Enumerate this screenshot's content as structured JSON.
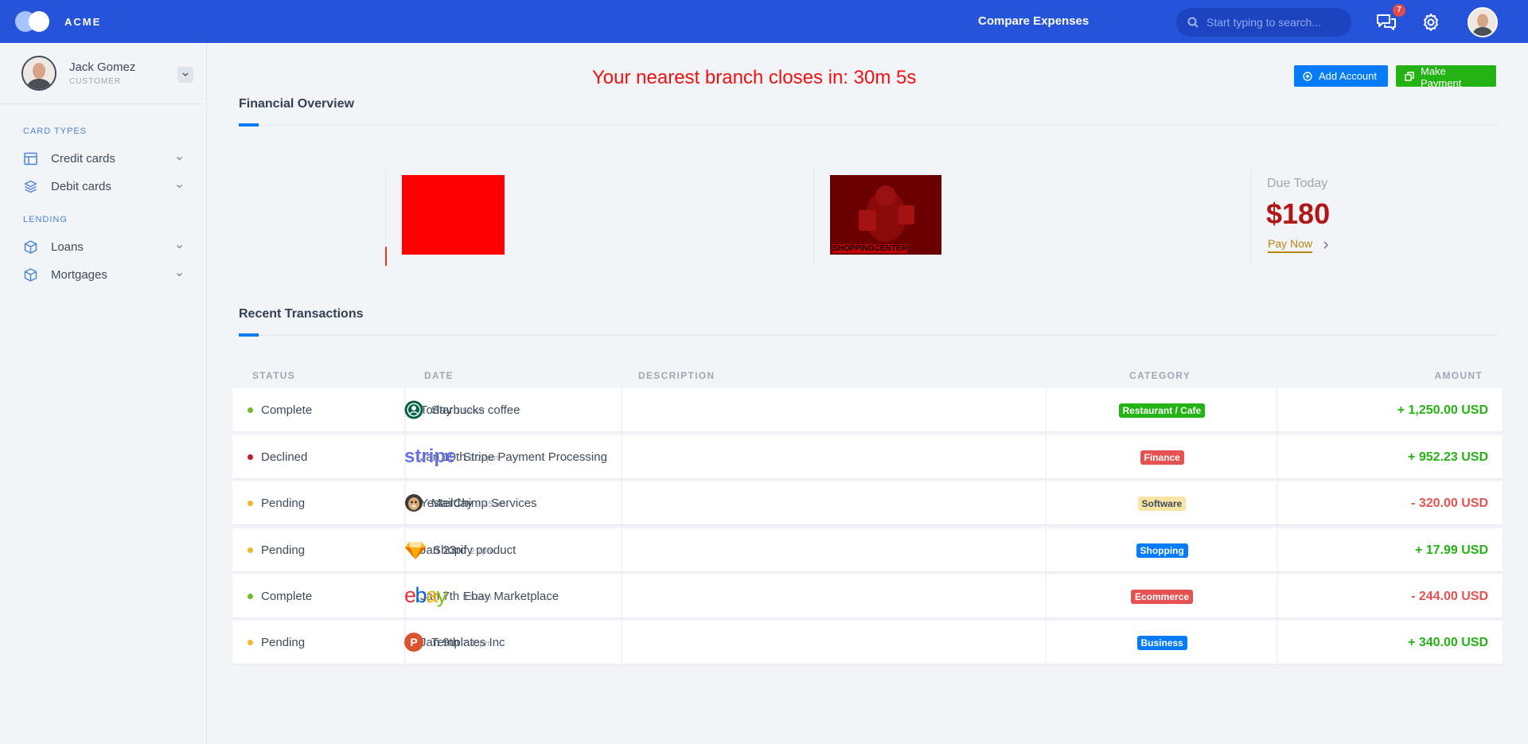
{
  "topbar": {
    "brand": "ACME",
    "compare_link": "Compare Expenses",
    "search_placeholder": "Start typing to search...",
    "messages_count": "7"
  },
  "sidebar": {
    "user_name": "Jack Gomez",
    "user_role": "CUSTOMER",
    "sections": [
      {
        "label": "CARD TYPES",
        "items": [
          {
            "label": "Credit cards",
            "icon": "layout-icon"
          },
          {
            "label": "Debit cards",
            "icon": "layers-icon"
          }
        ]
      },
      {
        "label": "LENDING",
        "items": [
          {
            "label": "Loans",
            "icon": "box-icon"
          },
          {
            "label": "Mortgages",
            "icon": "box-icon"
          }
        ]
      }
    ]
  },
  "main": {
    "countdown": "Your nearest branch closes in: 30m 5s",
    "add_account_label": "Add Account",
    "make_payment_label": "Make Payment",
    "financial_overview_title": "Financial Overview",
    "promo_text": "SHOPPINGCENTER",
    "due_label": "Due Today",
    "due_amount": "$180",
    "pay_now_label": "Pay Now",
    "recent_transactions_title": "Recent Transactions"
  },
  "table": {
    "headers": {
      "status": "STATUS",
      "date": "DATE",
      "description": "DESCRIPTION",
      "category": "CATEGORY",
      "amount": "AMOUNT"
    },
    "rows": [
      {
        "status": "Complete",
        "status_color": "#6fbf2a",
        "date": "Today",
        "time": "1:52am",
        "description": "Starbucks coffee",
        "logo": "starbucks-logo",
        "category": "Restaurant / Cafe",
        "category_bg": "#24b314",
        "category_fg": "#ffffff",
        "amount": "+ 1,250.00 USD",
        "amount_color": "#24b314"
      },
      {
        "status": "Declined",
        "status_color": "#c01e26",
        "date": "Jan 19th",
        "time": "3:22pm",
        "description": "Stripe Payment Processing",
        "logo": "stripe-logo",
        "category": "Finance",
        "category_bg": "#e65252",
        "category_fg": "#ffffff",
        "amount": "+ 952.23 USD",
        "amount_color": "#24b314"
      },
      {
        "status": "Pending",
        "status_color": "#f0b730",
        "date": "Yesterday",
        "time": "7:45am",
        "description": "MailChimp Services",
        "logo": "mailchimp-logo",
        "category": "Software",
        "category_bg": "#f8e5a6",
        "category_fg": "#3e4b5b",
        "amount": "- 320.00 USD",
        "amount_color": "#e65252"
      },
      {
        "status": "Pending",
        "status_color": "#f0b730",
        "date": "Jan 23rd",
        "time": "2:7pm",
        "description": "Shopify product",
        "logo": "sketch-logo",
        "category": "Shopping",
        "category_bg": "#047bf8",
        "category_fg": "#ffffff",
        "amount": "+ 17.99 USD",
        "amount_color": "#24b314"
      },
      {
        "status": "Complete",
        "status_color": "#6fbf2a",
        "date": "Jan 7th",
        "time": "9:51am",
        "description": "Ebay Marketplace",
        "logo": "ebay-logo",
        "category": "Ecommerce",
        "category_bg": "#e65252",
        "category_fg": "#ffffff",
        "amount": "- 244.00 USD",
        "amount_color": "#e65252"
      },
      {
        "status": "Pending",
        "status_color": "#f0b730",
        "date": "Jan 9th",
        "time": "7:45pm",
        "description": "Templates Inc",
        "logo": "producthunt-logo",
        "category": "Business",
        "category_bg": "#047bf8",
        "category_fg": "#ffffff",
        "amount": "+ 340.00 USD",
        "amount_color": "#24b314"
      }
    ]
  }
}
